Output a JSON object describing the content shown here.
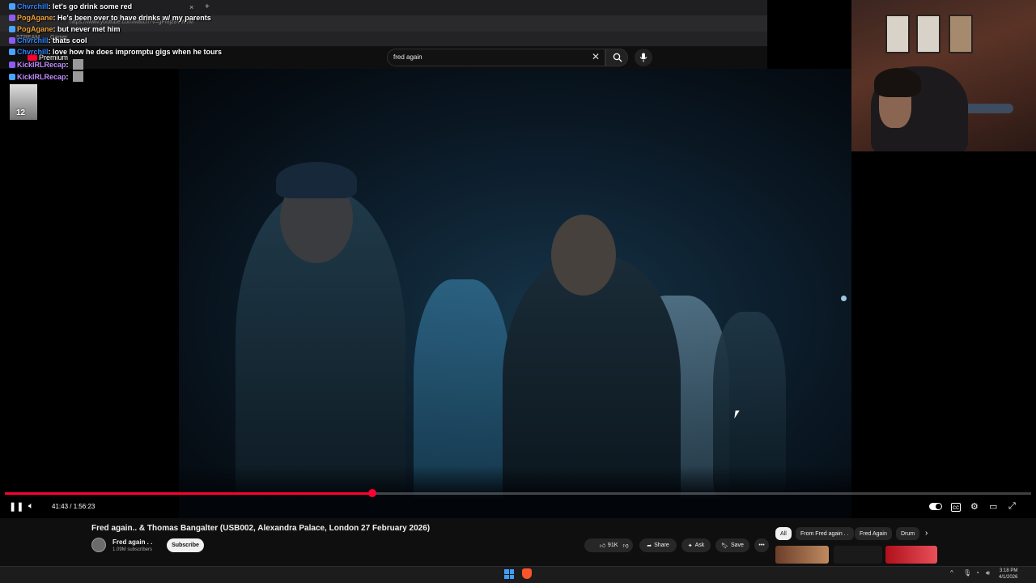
{
  "browser": {
    "url": "https://www.youtube.com/watch?v=gFf8jz8VWvM",
    "bookmarks": [
      "STREAM",
      "Gamer"
    ]
  },
  "youtube": {
    "logo_label": "Premium",
    "search_value": "fred again",
    "search_icon": "search-icon",
    "mic_icon": "mic-icon",
    "clear_icon": "close-icon"
  },
  "player": {
    "time": "41:43 / 1:56:23",
    "progress": 0.358,
    "accent_color": "#ff0033"
  },
  "video": {
    "title": "Fred again.. & Thomas Bangalter (USB002, Alexandra Palace, London 27 February 2026)",
    "channel": "Fred again . .",
    "subscribers": "1.09M subscribers",
    "subscribe_label": "Subscribe",
    "likes": "91K",
    "share_label": "Share",
    "ask_label": "Ask",
    "save_label": "Save"
  },
  "chips": [
    "All",
    "From Fred again . .",
    "Fred Again",
    "Drum"
  ],
  "chat": [
    {
      "user": "Chvrchill",
      "color": "#2e86ff",
      "message": "let's go drink some red"
    },
    {
      "user": "PogAgane",
      "color": "#e8a23a",
      "message": "He's been over to have drinks w/ my parents"
    },
    {
      "user": "PogAgane",
      "color": "#e8a23a",
      "message": "but never met him"
    },
    {
      "user": "Chvrchill",
      "color": "#2e86ff",
      "message": "thats cool"
    },
    {
      "user": "Chvrchill",
      "color": "#2e86ff",
      "message": "love how he does impromptu gigs when he tours"
    },
    {
      "user": "KickIRLRecap",
      "color": "#c08bff",
      "message": ""
    },
    {
      "user": "KickIRLRecap",
      "color": "#c08bff",
      "message": ""
    }
  ],
  "chat_avatar_label": "12",
  "taskbar": {
    "time": "3:18 PM",
    "date": "4/1/2026"
  }
}
